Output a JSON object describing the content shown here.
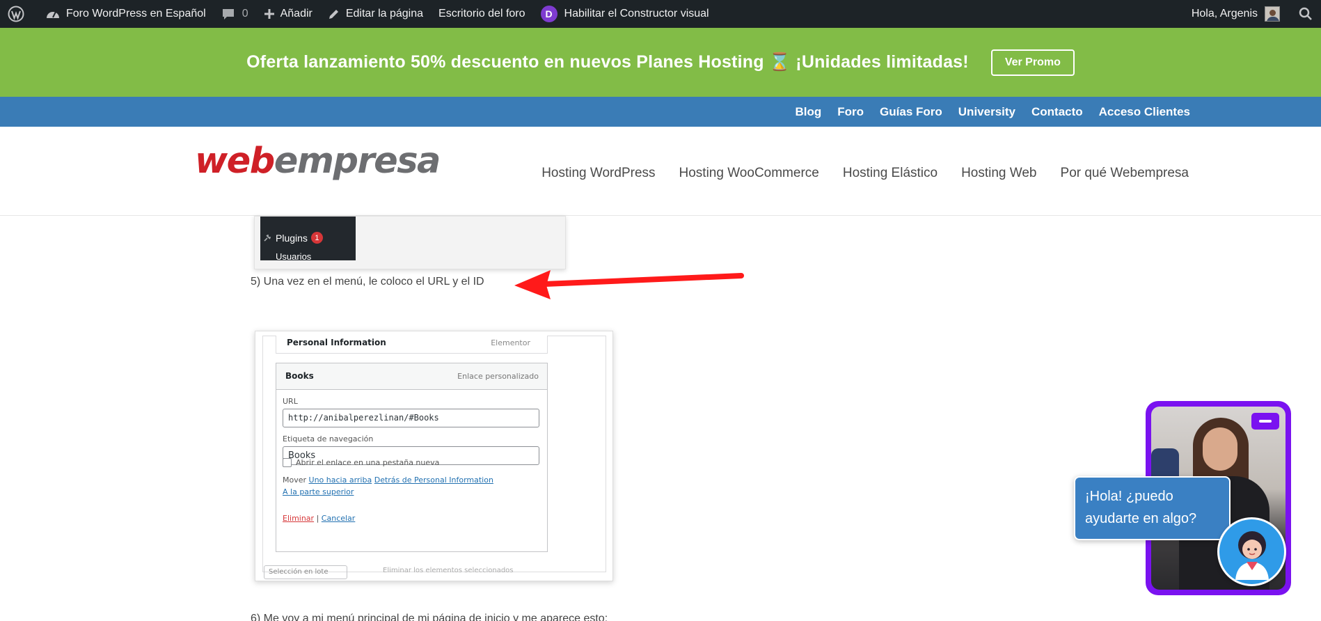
{
  "adminbar": {
    "site_name": "Foro WordPress en Español",
    "comments_count": "0",
    "add_label": "Añadir",
    "edit_label": "Editar la página",
    "forum_desk_label": "Escritorio del foro",
    "divi_letter": "D",
    "builder_label": "Habilitar el Constructor visual",
    "greeting": "Hola, Argenis"
  },
  "promo": {
    "text": "Oferta lanzamiento 50% descuento en nuevos Planes Hosting ⌛ ¡Unidades limitadas!",
    "button": "Ver Promo",
    "bg_color": "#82bc47"
  },
  "topnav": {
    "items": [
      "Blog",
      "Foro",
      "Guías Foro",
      "University",
      "Contacto",
      "Acceso Clientes"
    ],
    "bg_color": "#3a7cb6"
  },
  "header": {
    "logo_web": "web",
    "logo_empresa": "empresa",
    "nav": [
      "Hosting WordPress",
      "Hosting WooCommerce",
      "Hosting Elástico",
      "Hosting Web",
      "Por qué Webempresa"
    ]
  },
  "content": {
    "ss1_plugins": "Plugins",
    "ss1_badge": "1",
    "ss1_usuarios": "Usuarios",
    "step5": "5) Una vez en el menú, le coloco el URL y el ID",
    "step6": "6) Me voy a mi menú principal de mi página de inicio y me aparece esto:",
    "ss2": {
      "pi_title": "Personal Information",
      "pi_type": "Elementor",
      "item_title": "Books",
      "item_type": "Enlace personalizado",
      "url_label": "URL",
      "url_value": "http://anibalperezlinan/#Books",
      "nav_label": "Etiqueta de navegación",
      "nav_value": "Books",
      "newtab_label": "Abrir el enlace en una pestaña nueva",
      "move_label": "Mover",
      "move_up": "Uno hacia arriba",
      "move_under": "Detrás de Personal Information",
      "move_top": "A la parte superior",
      "delete": "Eliminar",
      "separator": "|",
      "cancel": "Cancelar",
      "bulk": "Selección en lote",
      "bulk_remove": "Eliminar los elementos seleccionados"
    }
  },
  "chat": {
    "bubble": "¡Hola! ¿puedo ayudarte en algo?",
    "accent": "#7a12f0"
  }
}
